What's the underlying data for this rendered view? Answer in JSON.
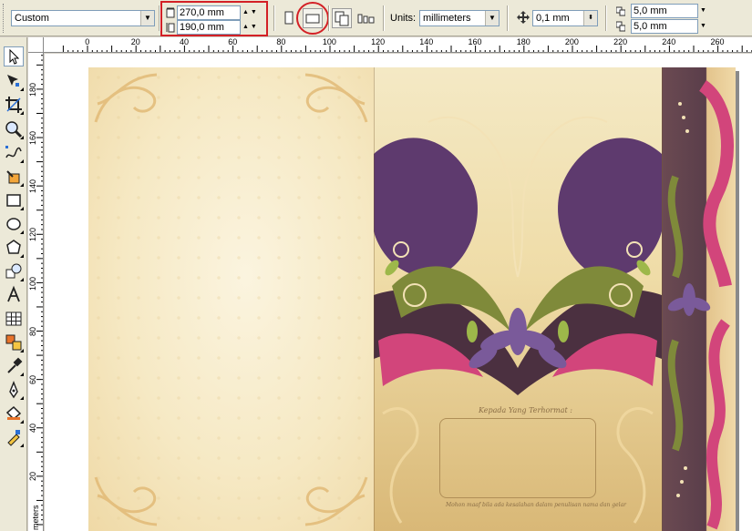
{
  "propbar": {
    "paper_preset": "Custom",
    "width_value": "270,0 mm",
    "height_value": "190,0 mm",
    "units_label": "Units:",
    "units_value": "millimeters",
    "nudge_value": "0,1 mm",
    "duplicate_x": "5,0 mm",
    "duplicate_y": "5,0 mm"
  },
  "rulers": {
    "horizontal_ticks": [
      "0",
      "20",
      "40",
      "60",
      "80",
      "100",
      "120",
      "140",
      "160",
      "180",
      "200",
      "220",
      "240",
      "260"
    ],
    "vertical_ticks": [
      "180",
      "160",
      "140",
      "120",
      "100",
      "80",
      "60",
      "40",
      "20"
    ],
    "vertical_unit": "meters"
  },
  "card": {
    "to_label": "Kepada Yang Terhormat :",
    "footer_note": "Mohon maaf bila ada kesalahan dalam penulisan nama dan gelar"
  },
  "colors": {
    "highlight": "#d32026",
    "purple": "#5e3a6e",
    "pink": "#d2457b",
    "olive": "#7f8a3a",
    "cream": "#f6e9c4"
  },
  "icons": {
    "toolbox": [
      "pick-tool-icon",
      "shape-tool-icon",
      "crop-tool-icon",
      "zoom-tool-icon",
      "freehand-tool-icon",
      "smart-fill-icon",
      "rectangle-tool-icon",
      "ellipse-tool-icon",
      "polygon-tool-icon",
      "basic-shapes-icon",
      "text-tool-icon",
      "table-tool-icon",
      "interactive-blend-icon",
      "eyedropper-icon",
      "outline-pen-icon",
      "fill-tool-icon",
      "interactive-fill-icon"
    ]
  }
}
